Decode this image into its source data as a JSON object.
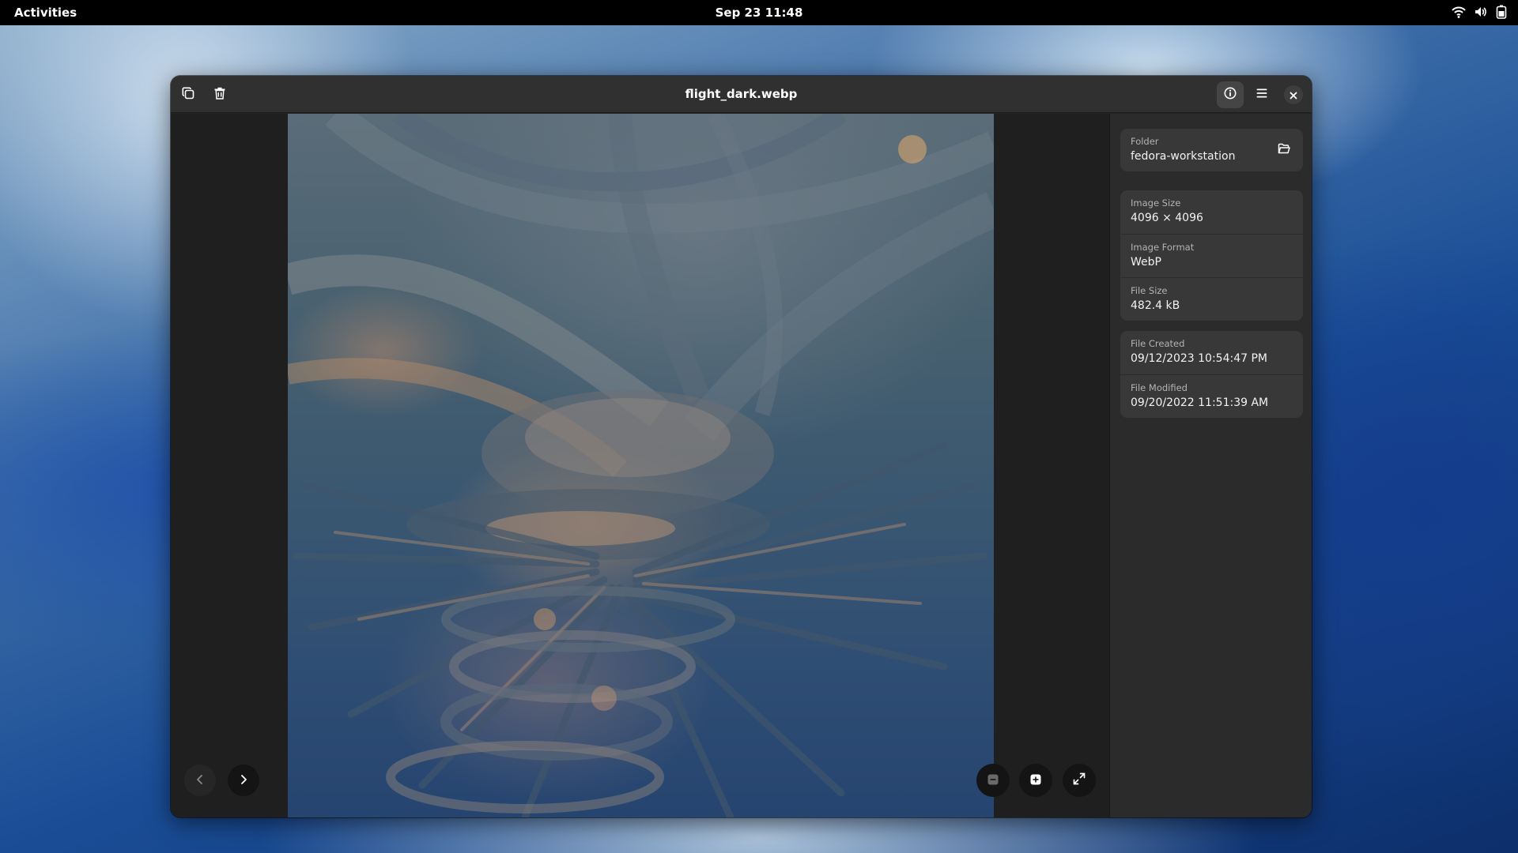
{
  "topbar": {
    "activities": "Activities",
    "clock": "Sep 23  11:48",
    "tray_icons": [
      "wifi-icon",
      "volume-icon",
      "battery-icon"
    ]
  },
  "window": {
    "title": "flight_dark.webp",
    "header_left_buttons": [
      "copy-icon",
      "trash-icon"
    ],
    "header_right_buttons": [
      "info-icon",
      "hamburger-menu-icon",
      "close-icon"
    ]
  },
  "viewer": {
    "nav_buttons": [
      "previous-icon",
      "next-icon"
    ],
    "zoom_buttons": [
      "zoom-out-icon",
      "zoom-in-icon",
      "fullscreen-icon"
    ]
  },
  "properties": {
    "folder": {
      "label": "Folder",
      "value": "fedora-workstation"
    },
    "image_size": {
      "label": "Image Size",
      "value": "4096 × 4096"
    },
    "image_format": {
      "label": "Image Format",
      "value": "WebP"
    },
    "file_size": {
      "label": "File Size",
      "value": "482.4 kB"
    },
    "file_created": {
      "label": "File Created",
      "value": "09/12/2023 10:54:47 PM"
    },
    "file_modified": {
      "label": "File Modified",
      "value": "09/20/2022 11:51:39 AM"
    }
  },
  "colors": {
    "window_bg": "#242424",
    "headerbar_bg": "#303030",
    "sidebar_bg": "#2b2b2b",
    "card_bg": "#383838",
    "topbar_bg": "#000000"
  }
}
